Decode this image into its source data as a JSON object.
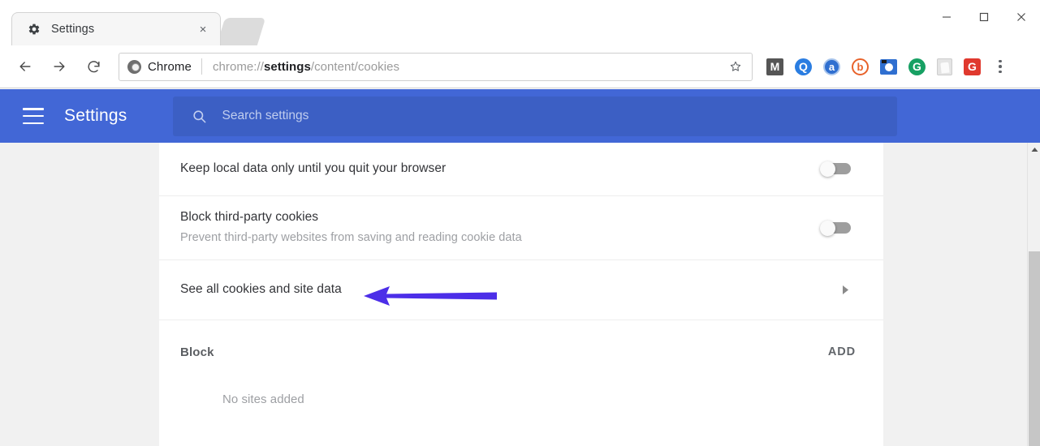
{
  "window": {
    "minimize_label": "─",
    "maximize_label": "□",
    "close_label": "×"
  },
  "tab": {
    "title": "Settings",
    "favicon": "gear-icon",
    "close_label": "×"
  },
  "toolbar": {
    "back_label": "←",
    "forward_label": "→",
    "reload_label": "↻",
    "security_chip_label": "Chrome",
    "url_prefix": "chrome://",
    "url_bold": "settings",
    "url_suffix": "/content/cookies",
    "bookmark_icon": "star-outline-icon",
    "extensions": [
      {
        "name": "mailtrack-extension-icon",
        "glyph": "M",
        "style": "ext-m"
      },
      {
        "name": "quora-extension-icon",
        "glyph": "Q",
        "style": "ext-q"
      },
      {
        "name": "amazon-assistant-extension-icon",
        "glyph": "a",
        "style": "ext-a"
      },
      {
        "name": "bitly-extension-icon",
        "glyph": "b",
        "style": "ext-b"
      },
      {
        "name": "screenshot-extension-icon",
        "glyph": "",
        "style": "ext-cam"
      },
      {
        "name": "grammarly-green-extension-icon",
        "glyph": "G",
        "style": "ext-g-green"
      },
      {
        "name": "notes-extension-icon",
        "glyph": "",
        "style": "ext-gray"
      },
      {
        "name": "grammarly-red-extension-icon",
        "glyph": "G",
        "style": "ext-g-red"
      }
    ],
    "menu_label": "chrome-menu-icon"
  },
  "settings_header": {
    "menu_icon": "hamburger-menu-icon",
    "title": "Settings",
    "search_icon": "search-icon",
    "search_placeholder": "Search settings",
    "search_value": "",
    "background_color": "#4267d6",
    "search_background_color": "#3c5fc4"
  },
  "content": {
    "rows": [
      {
        "title": "Keep local data only until you quit your browser",
        "subtitle": "",
        "control": "toggle",
        "toggle_state": "off"
      },
      {
        "title": "Block third-party cookies",
        "subtitle": "Prevent third-party websites from saving and reading cookie data",
        "control": "toggle",
        "toggle_state": "off"
      },
      {
        "title": "See all cookies and site data",
        "subtitle": "",
        "control": "chevron",
        "chevron_glyph": "▸"
      }
    ],
    "block_section": {
      "heading": "Block",
      "add_label": "ADD",
      "empty_text": "No sites added"
    }
  },
  "annotation": {
    "arrow_color": "#4c2ee8",
    "points_to": "See all cookies and site data"
  },
  "scrollbar": {
    "up_arrow_glyph": "▲",
    "position": "scrolled"
  }
}
